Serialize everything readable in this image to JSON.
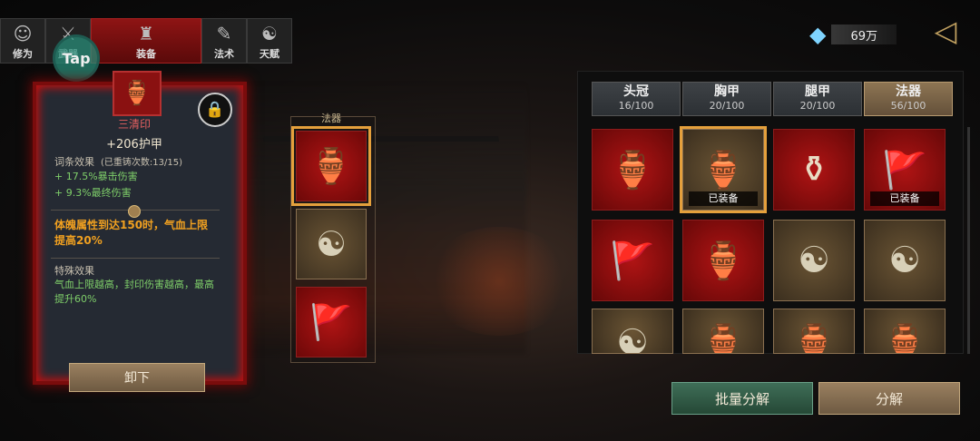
{
  "tabs": [
    {
      "label": "修为",
      "icon": "person-icon"
    },
    {
      "label": "武器",
      "icon": "sword-icon"
    },
    {
      "label": "装备",
      "icon": "robe-icon"
    },
    {
      "label": "法术",
      "icon": "scroll-icon"
    },
    {
      "label": "天赋",
      "icon": "taiji-icon"
    }
  ],
  "tap_hint": "Tap",
  "currency": {
    "amount": "69万",
    "icon": "crystal-icon"
  },
  "detail": {
    "name": "三清印",
    "armor_value": "+206",
    "armor_label": "护甲",
    "affix_title": "词条效果",
    "affix_recast": "(已重铸次数:13/15)",
    "affixes": [
      "+ 17.5%暴击伤害",
      "+ 9.3%最终伤害"
    ],
    "set_bonus": "体魄属性到达150时，气血上限提高20%",
    "special_title": "特殊效果",
    "special_text": "气血上限越高，封印伤害越高，最高提升60%",
    "unequip_label": "卸下"
  },
  "slot_column": {
    "label": "法器"
  },
  "categories": [
    {
      "name": "头冠",
      "count": "16/100"
    },
    {
      "name": "胸甲",
      "count": "20/100"
    },
    {
      "name": "腿甲",
      "count": "20/100"
    },
    {
      "name": "法器",
      "count": "56/100"
    }
  ],
  "inventory": {
    "equipped_label": "已装备"
  },
  "buttons": {
    "batch_decompose": "批量分解",
    "decompose": "分解"
  },
  "colors": {
    "accent_red": "#b01414",
    "gold_frame": "#e5a03c",
    "affix_green": "#7fcf6a",
    "set_orange": "#f0a020"
  }
}
